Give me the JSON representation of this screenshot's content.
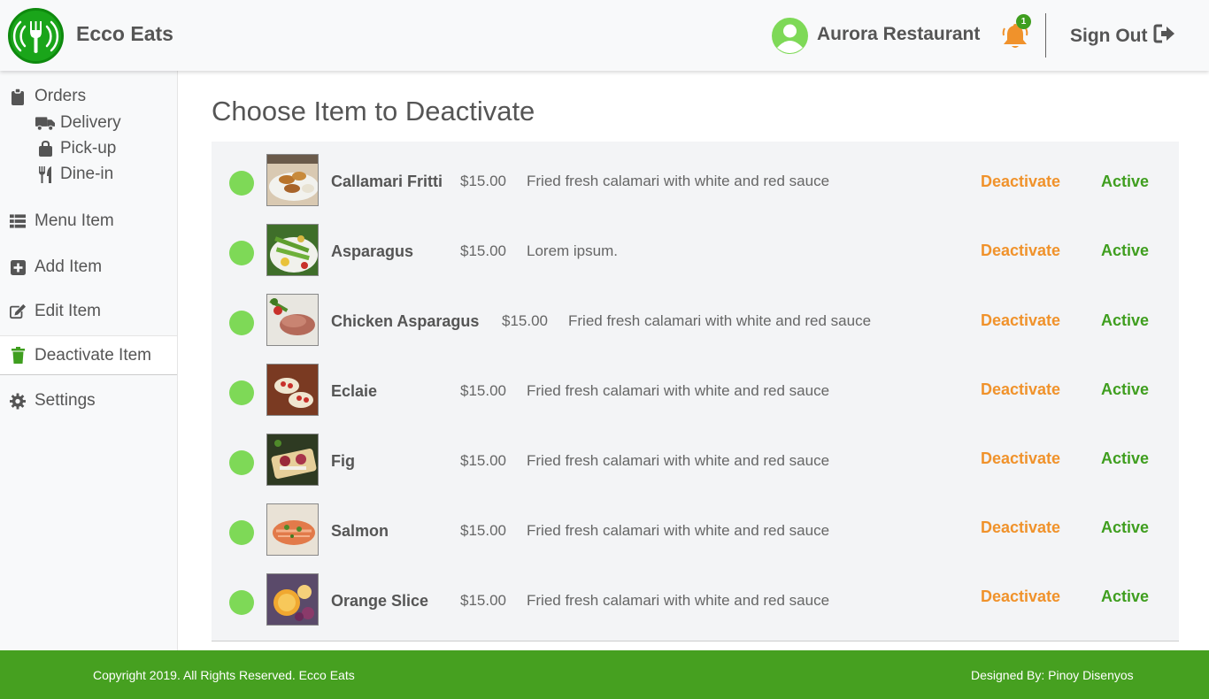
{
  "header": {
    "brand": "Ecco Eats",
    "restaurant_name": "Aurora Restaurant",
    "notification_count": "1",
    "sign_out_label": "Sign Out",
    "icons": {
      "logo": "fork-wifi-logo",
      "avatar": "user-circle-icon",
      "bell": "bell-icon",
      "sign_out": "sign-out-icon"
    }
  },
  "sidebar": {
    "orders": {
      "label": "Orders",
      "icon": "clipboard-icon"
    },
    "order_types": [
      {
        "label": "Delivery",
        "icon": "truck-icon"
      },
      {
        "label": "Pick-up",
        "icon": "shopping-bag-icon"
      },
      {
        "label": "Dine-in",
        "icon": "utensils-icon"
      }
    ],
    "items": [
      {
        "label": "Menu Item",
        "icon": "list-icon"
      },
      {
        "label": "Add Item",
        "icon": "plus-square-icon"
      },
      {
        "label": "Edit Item",
        "icon": "edit-icon"
      },
      {
        "label": "Deactivate Item",
        "icon": "trash-icon",
        "active": true
      },
      {
        "label": "Settings",
        "icon": "gear-icon"
      }
    ]
  },
  "main": {
    "title": "Choose Item to Deactivate",
    "deactivate_label": "Deactivate",
    "menu_items": [
      {
        "name": "Callamari Fritti",
        "price": "$15.00",
        "description": "Fried fresh calamari with white and red sauce",
        "status": "Active"
      },
      {
        "name": "Asparagus",
        "price": "$15.00",
        "description": "Lorem ipsum.",
        "status": "Active"
      },
      {
        "name": "Chicken Asparagus",
        "price": "$15.00",
        "description": "Fried fresh calamari with white and red sauce",
        "status": "Active"
      },
      {
        "name": "Eclaie",
        "price": "$15.00",
        "description": "Fried fresh calamari with white and red sauce",
        "status": "Active"
      },
      {
        "name": "Fig",
        "price": "$15.00",
        "description": "Fried fresh calamari with white and red sauce",
        "status": "Active"
      },
      {
        "name": "Salmon",
        "price": "$15.00",
        "description": "Fried fresh calamari with white and red sauce",
        "status": "Active"
      },
      {
        "name": "Orange Slice",
        "price": "$15.00",
        "description": "Fried fresh calamari with white and red sauce",
        "status": "Active"
      }
    ]
  },
  "footer": {
    "copyright": "Copyright 2019. All Rights Reserved. Ecco Eats",
    "designed_by": "Designed By: Pinoy Disenyos"
  },
  "colors": {
    "brand_green": "#46a020",
    "status_dot": "#7ed957",
    "deactivate_orange": "#f0922b",
    "active_green": "#3f9e1f",
    "bell_orange": "#f0922b"
  }
}
